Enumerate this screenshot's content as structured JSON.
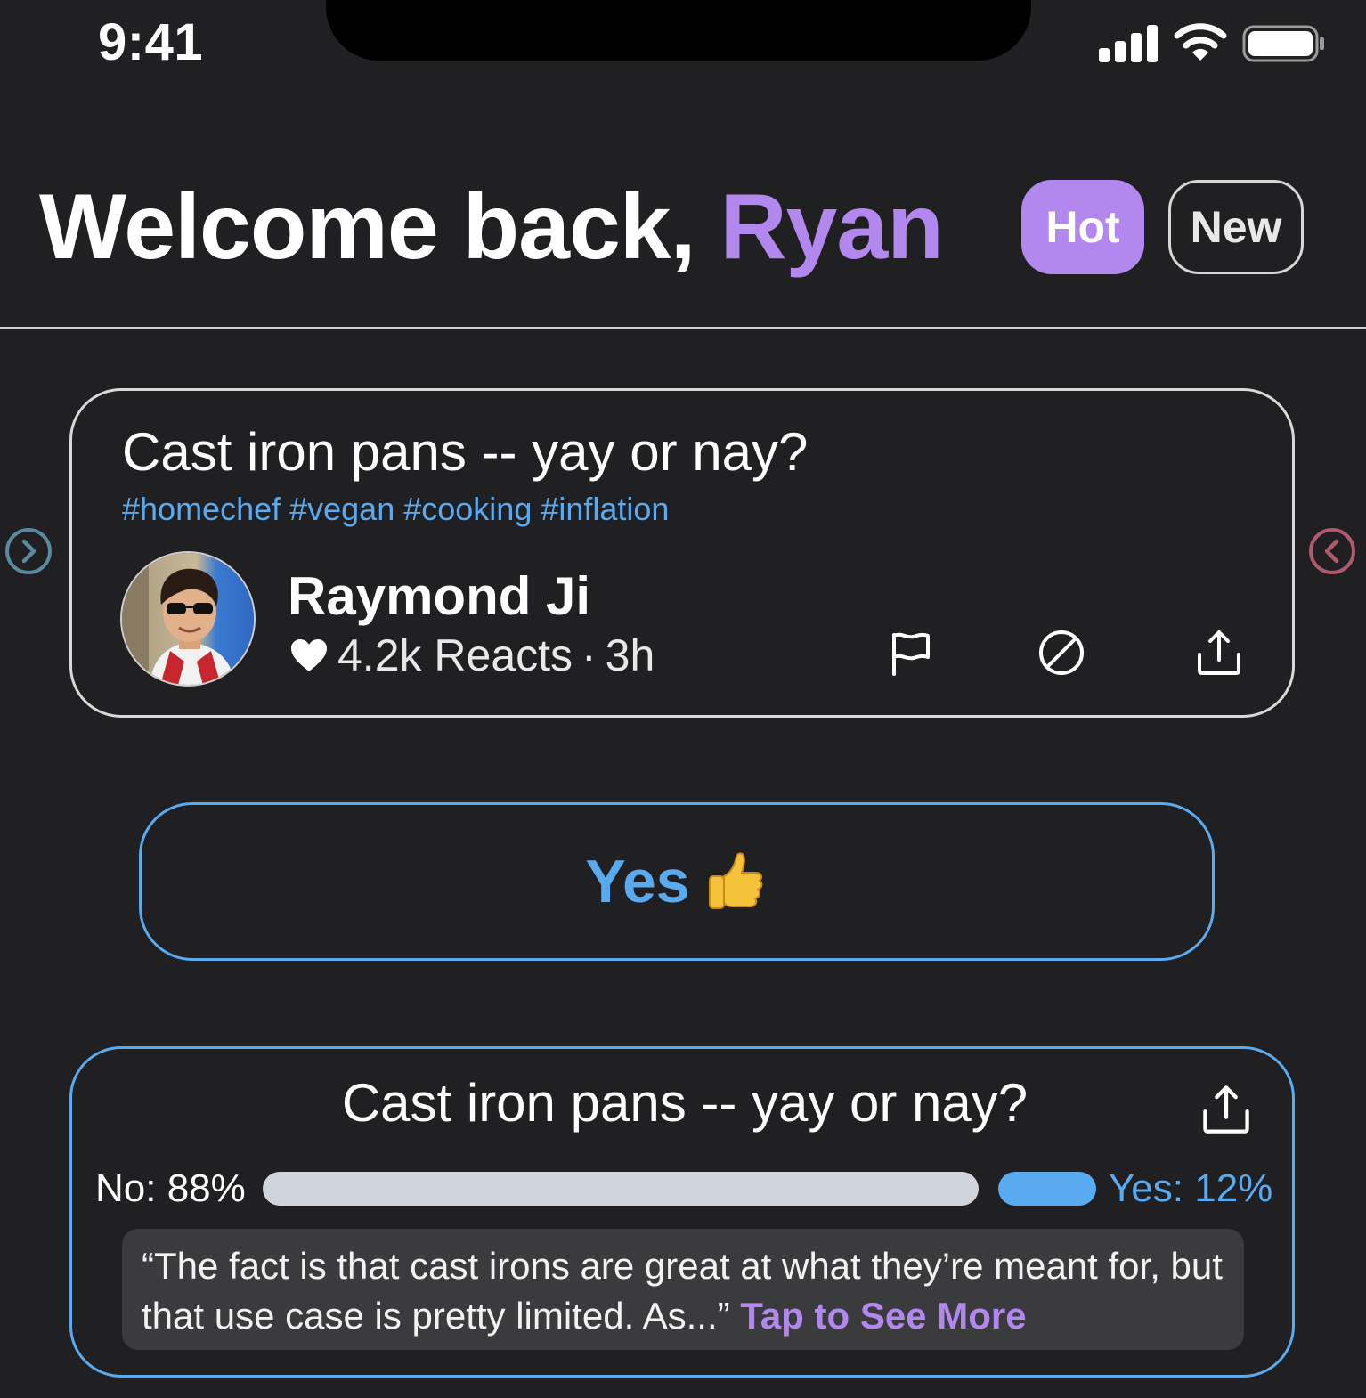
{
  "status_bar": {
    "time": "9:41"
  },
  "header": {
    "greeting_prefix": "Welcome back, ",
    "user_name": "Ryan",
    "tabs": [
      {
        "label": "Hot",
        "active": true
      },
      {
        "label": "New",
        "active": false
      }
    ]
  },
  "post": {
    "title": "Cast iron pans -- yay or nay?",
    "tags": "#homechef #vegan #cooking #inflation",
    "author": "Raymond Ji",
    "reacts": "4.2k Reacts",
    "separator": "·",
    "age": "3h",
    "actions": [
      "flag-icon",
      "block-icon",
      "share-icon"
    ]
  },
  "vote": {
    "label": "Yes",
    "emoji": "👍"
  },
  "results": {
    "title": "Cast iron pans -- yay or nay?",
    "no_label": "No: 88%",
    "yes_label": "Yes: 12%",
    "no_fraction": 0.88,
    "yes_fraction": 0.12,
    "quote": "“The fact is that cast irons are great at what they’re meant for, but that use case is pretty limited. As...”",
    "see_more": "Tap to See More"
  },
  "colors": {
    "accent_purple": "#b388ee",
    "accent_blue": "#5aaaf0",
    "side_right_arrow": "#5a8aa0",
    "side_left_arrow": "#b05a6e"
  }
}
